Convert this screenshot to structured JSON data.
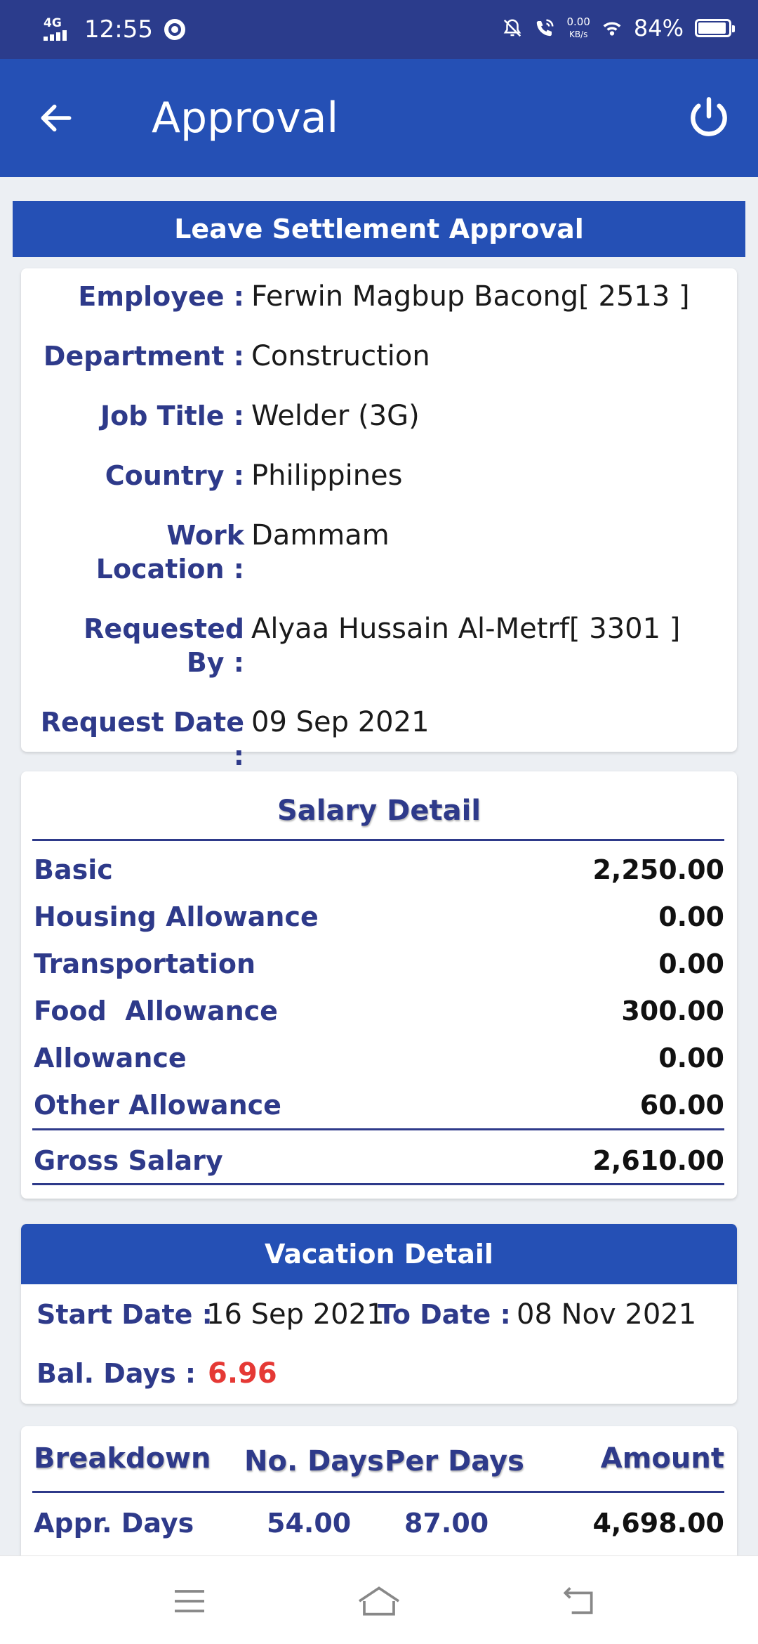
{
  "status_bar": {
    "network": "4G",
    "time": "12:55",
    "speed_value": "0.00",
    "speed_unit": "KB/s",
    "battery": "84%",
    "battery_level": 0.84,
    "icons": [
      "chrome-icon",
      "mute-icon",
      "wifi-call-icon",
      "wifi-icon",
      "battery-icon"
    ]
  },
  "app_bar": {
    "title": "Approval",
    "back_icon": "arrow-left-icon",
    "power_icon": "power-icon",
    "background": "#2550b5"
  },
  "section_title": "Leave Settlement Approval",
  "employee": {
    "employee_label": "Employee :",
    "employee_value": "Ferwin Magbup Bacong[ 2513 ]",
    "department_label": "Department :",
    "department_value": "Construction",
    "job_title_label": "Job Title :",
    "job_title_value": "Welder (3G)",
    "country_label": "Country :",
    "country_value": "Philippines",
    "work_location_label_1": "Work",
    "work_location_label_2": "Location :",
    "work_location_value": "Dammam",
    "requested_by_label_1": "Requested",
    "requested_by_label_2": "By :",
    "requested_by_value": "Alyaa Hussain Al-Metrf[ 3301 ]",
    "request_date_label": "Request Date :",
    "request_date_value": "09 Sep 2021"
  },
  "salary": {
    "title": "Salary Detail",
    "rows": [
      {
        "label": "Basic",
        "value": "2,250.00"
      },
      {
        "label": "Housing Allowance",
        "value": "0.00"
      },
      {
        "label": "Transportation",
        "value": "0.00"
      },
      {
        "label": "Food  Allowance",
        "value": "300.00"
      },
      {
        "label": "Allowance",
        "value": "0.00"
      },
      {
        "label": "Other Allowance",
        "value": "60.00"
      }
    ],
    "gross_label": "Gross Salary",
    "gross_value": "2,610.00"
  },
  "vacation": {
    "title": "Vacation Detail",
    "start_label": "Start Date :",
    "start_value": "16 Sep 2021",
    "to_label": "To Date :",
    "to_value": "08 Nov 2021",
    "bal_label": "Bal. Days :",
    "bal_value": "6.96",
    "bal_color": "#e53935"
  },
  "breakdown": {
    "headers": [
      "Breakdown",
      "No. Days",
      "Per Days",
      "Amount"
    ],
    "row": {
      "label": "Appr. Days",
      "days": "54.00",
      "per_day": "87.00",
      "amount": "4,698.00"
    }
  },
  "nav_bar": {
    "icons": [
      "menu-icon",
      "home-icon",
      "back-icon"
    ]
  }
}
